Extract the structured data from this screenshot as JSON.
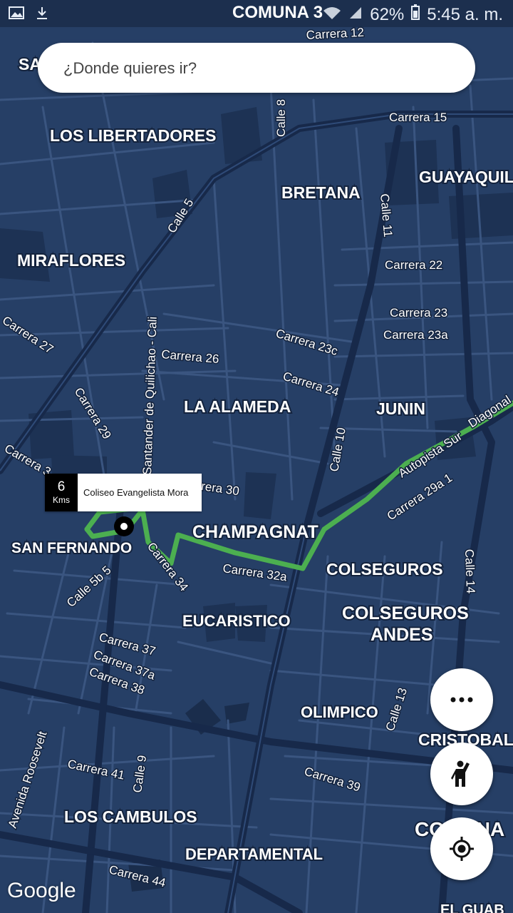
{
  "status_bar": {
    "title": "COMUNA 3",
    "battery": "62%",
    "time": "5:45 a. m.",
    "icons": [
      "image-icon",
      "download-icon",
      "wifi-icon",
      "signal-icon",
      "battery-icon"
    ]
  },
  "search": {
    "placeholder": "¿Donde quieres ir?"
  },
  "map": {
    "route_color": "#4caf50",
    "map_color": "#263f66",
    "neighborhoods": [
      "SAN",
      "LOS LIBERTADORES",
      "BRETANA",
      "GUAYAQUIL",
      "MIRAFLORES",
      "LA ALAMEDA",
      "JUNIN",
      "CHAMPAGNAT",
      "SAN FERNANDO",
      "COLSEGUROS",
      "COLSEGUROS",
      "ANDES",
      "EUCARISTICO",
      "OLIMPICO",
      "CRISTOBAL",
      "LOS CAMBULOS",
      "DEPARTAMENTAL",
      "CO",
      "INA",
      "EL GUAB"
    ],
    "streets": [
      "Carrera 12",
      "Carrera 15",
      "Calle 8",
      "Calle 5",
      "Calle 11",
      "Carrera 22",
      "Carrera 23",
      "Carrera 23a",
      "Carrera 23c",
      "Carrera 24",
      "Carrera 26",
      "Carrera 27",
      "Carrera 29",
      "Carrera 3",
      "Santander de Quilichao - Cali",
      "rrera 30",
      "Calle 10",
      "Autopista Sur",
      "Diagonal",
      "Carrera 29a 1",
      "Carrera 34",
      "Carrera 32a",
      "Calle 5b 5",
      "Calle 14",
      "Carrera 37",
      "Carrera 37a",
      "Carrera 38",
      "Calle 13",
      "Avenida Roosevelt",
      "Carrera 41",
      "Calle 9",
      "Carrera 39",
      "Carrera 44"
    ]
  },
  "callout": {
    "distance": "6",
    "unit": "Kms",
    "place": "Coliseo Evangelista Mora"
  },
  "fabs": {
    "more": "more-icon",
    "pickup": "hail-icon",
    "locate": "my-location-icon"
  },
  "google_logo": "Google"
}
